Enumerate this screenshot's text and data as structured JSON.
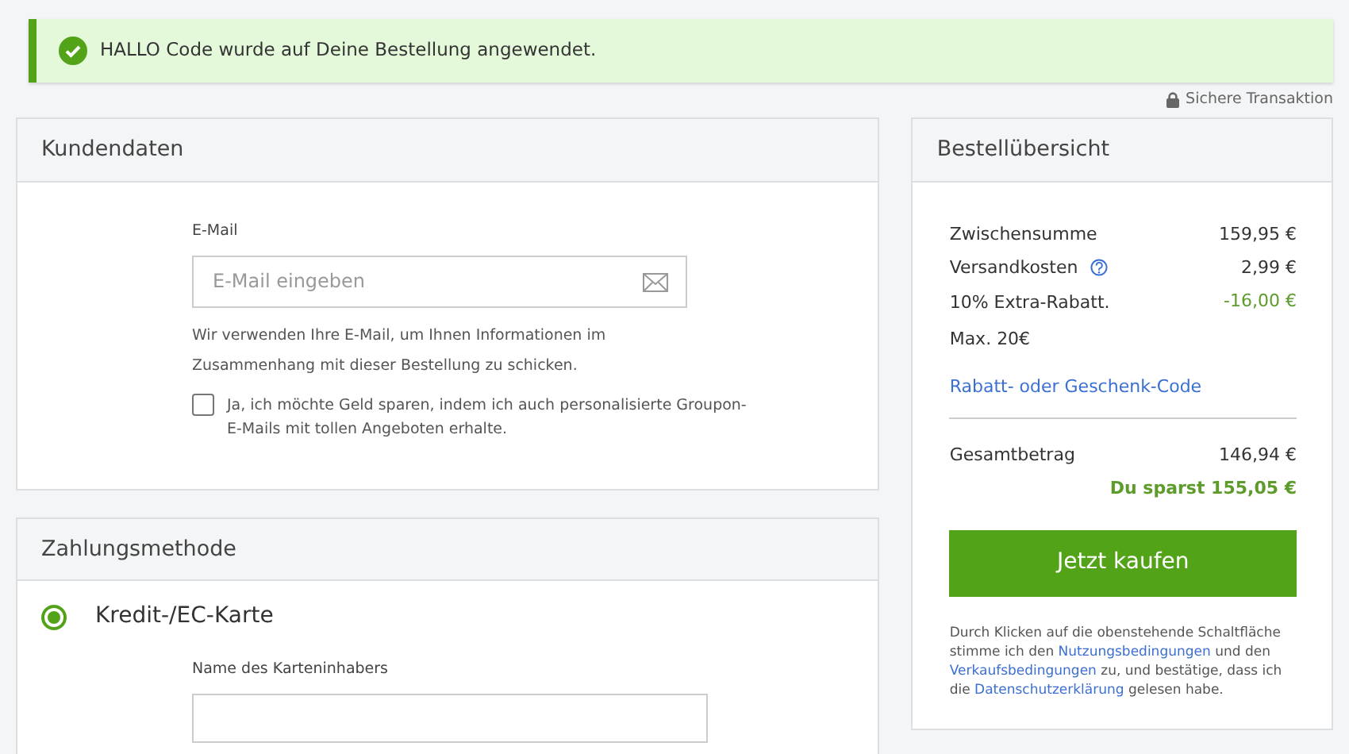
{
  "alert": {
    "text": "HALLO Code wurde auf Deine Bestellung angewendet."
  },
  "secure_note": "Sichere Transaktion",
  "customer": {
    "title": "Kundendaten",
    "email_label": "E-Mail",
    "email_placeholder": "E-Mail eingeben",
    "email_hint": "Wir verwenden Ihre E-Mail, um Ihnen Informationen im Zusammenhang mit dieser Bestellung zu schicken.",
    "newsletter": {
      "label": "Ja, ich möchte Geld sparen, indem ich auch personalisierte Groupon-E-Mails mit tollen Angeboten erhalte.",
      "checked": false
    }
  },
  "payment": {
    "title": "Zahlungsmethode",
    "methods": [
      {
        "label": "Kredit-/EC-Karte",
        "selected": true
      }
    ],
    "holder_label": "Name des Karteninhabers"
  },
  "summary": {
    "title": "Bestellübersicht",
    "lines": [
      {
        "label": "Zwischensumme",
        "value": "159,95 €",
        "kind": "plain"
      },
      {
        "label": "Versandkosten",
        "value": "2,99 €",
        "kind": "info"
      },
      {
        "label": "10% Extra-Rabatt. Max. 20€",
        "value": "-16,00 €",
        "kind": "discount"
      }
    ],
    "code_link": "Rabatt- oder Geschenk-Code",
    "total_label": "Gesamtbetrag",
    "total_value": "146,94 €",
    "savings": "Du sparst 155,05 €",
    "buy_button": "Jetzt kaufen",
    "legal": [
      {
        "kind": "text",
        "text": "Durch Klicken auf die obenstehende Schaltfläche stimme ich den "
      },
      {
        "kind": "link",
        "text": "Nutzungsbedingungen"
      },
      {
        "kind": "text",
        "text": " und den "
      },
      {
        "kind": "link",
        "text": "Verkaufsbedingungen"
      },
      {
        "kind": "text",
        "text": " zu, und bestätige, dass ich die "
      },
      {
        "kind": "link",
        "text": "Datenschutzerklärung"
      },
      {
        "kind": "text",
        "text": " gelesen habe."
      }
    ]
  }
}
